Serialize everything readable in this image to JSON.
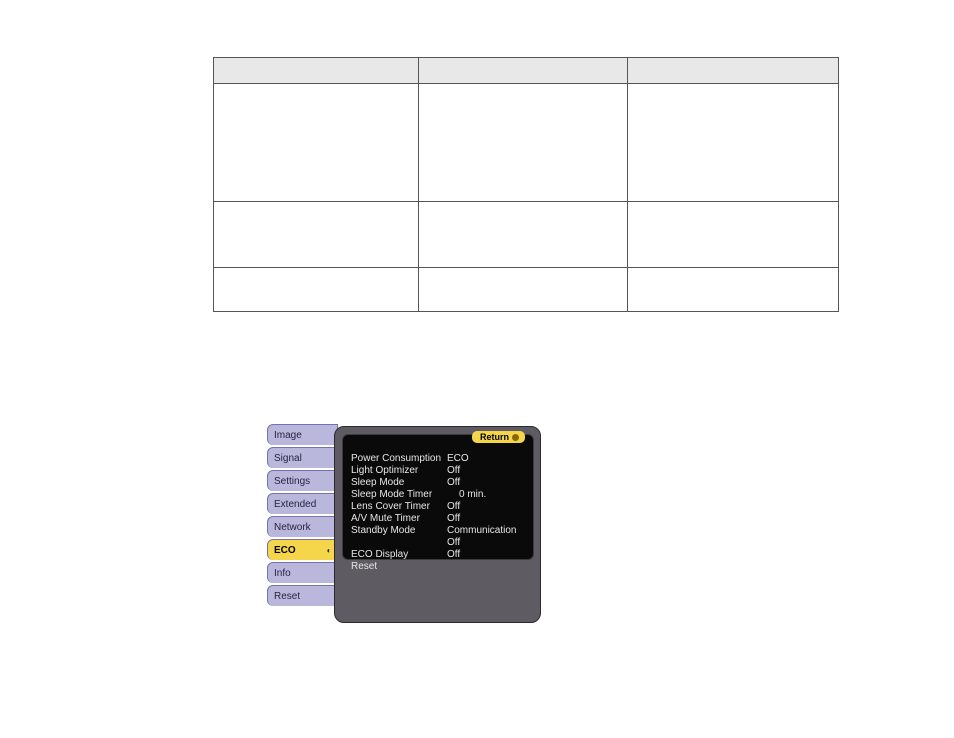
{
  "table": {
    "headers": [
      "",
      "",
      ""
    ],
    "rows": [
      [
        "",
        "",
        ""
      ],
      [
        "",
        "",
        ""
      ],
      [
        "",
        "",
        ""
      ]
    ]
  },
  "osd": {
    "sidebar": [
      {
        "label": "Image",
        "selected": false
      },
      {
        "label": "Signal",
        "selected": false
      },
      {
        "label": "Settings",
        "selected": false
      },
      {
        "label": "Extended",
        "selected": false
      },
      {
        "label": "Network",
        "selected": false
      },
      {
        "label": "ECO",
        "selected": true
      },
      {
        "label": "Info",
        "selected": false
      },
      {
        "label": "Reset",
        "selected": false
      }
    ],
    "return_label": "Return",
    "items": [
      {
        "label": "Power Consumption",
        "value": "ECO"
      },
      {
        "label": "Light Optimizer",
        "value": "Off"
      },
      {
        "label": "Sleep Mode",
        "value": "Off"
      },
      {
        "label": "Sleep Mode Timer",
        "value": "0 min.",
        "indent": true
      },
      {
        "label": "Lens Cover Timer",
        "value": "Off"
      },
      {
        "label": "A/V Mute Timer",
        "value": "Off"
      },
      {
        "label": "Standby Mode",
        "value": "Communication Off"
      },
      {
        "label": "ECO Display",
        "value": "Off"
      },
      {
        "label": "Reset",
        "value": ""
      }
    ]
  },
  "icons": {
    "chevron": "◐"
  }
}
